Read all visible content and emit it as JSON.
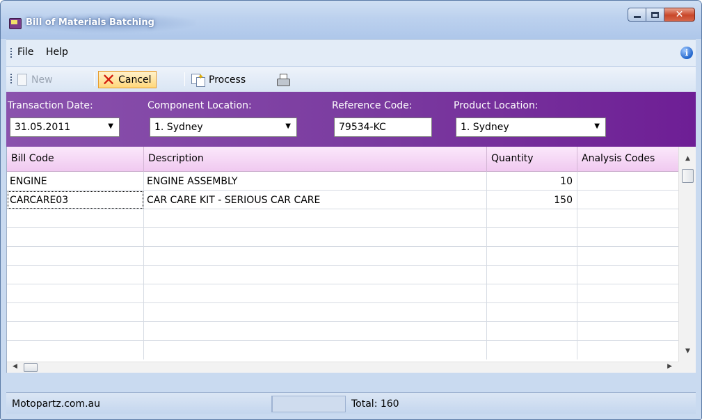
{
  "window": {
    "title": "Bill of Materials Batching",
    "accent_color": "#7a3a9f"
  },
  "menu": {
    "items": [
      "File",
      "Help"
    ]
  },
  "toolbar": {
    "new_label": "New",
    "cancel_label": "Cancel",
    "process_label": "Process"
  },
  "header": {
    "transaction_date_label": "Transaction Date:",
    "transaction_date_value": "31.05.2011",
    "component_location_label": "Component Location:",
    "component_location_value": "1. Sydney",
    "reference_code_label": "Reference Code:",
    "reference_code_value": "79534-KC",
    "product_location_label": "Product Location:",
    "product_location_value": "1. Sydney"
  },
  "grid": {
    "columns": [
      "Bill Code",
      "Description",
      "Quantity",
      "Analysis Codes"
    ],
    "rows": [
      {
        "bill_code": "ENGINE",
        "description": "ENGINE ASSEMBLY",
        "quantity": "10",
        "analysis_codes": ""
      },
      {
        "bill_code": "CARCARE03",
        "description": "CAR CARE KIT - SERIOUS CAR CARE",
        "quantity": "150",
        "analysis_codes": ""
      }
    ]
  },
  "status": {
    "company": "Motopartz.com.au",
    "total": "Total: 160"
  }
}
